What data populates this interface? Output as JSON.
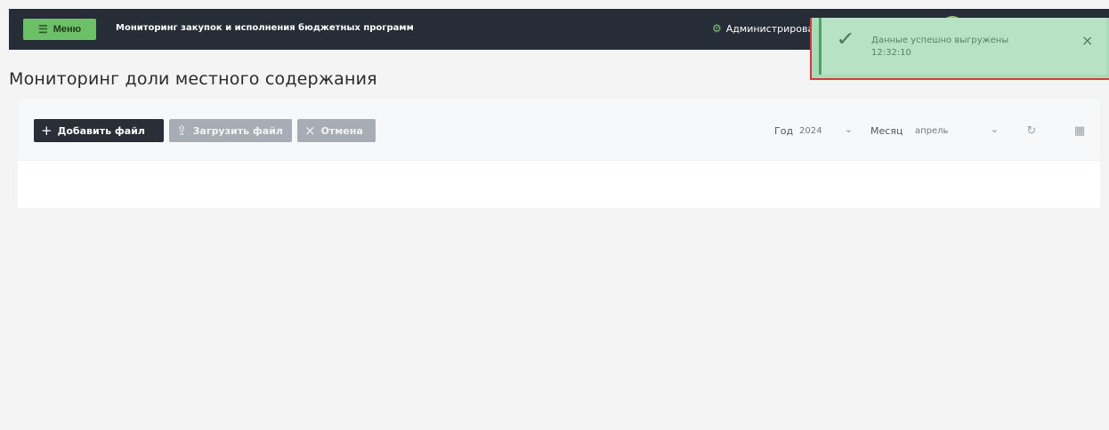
{
  "header": {
    "menu_label": "Меню",
    "app_title": "Мониторинг закупок и исполнения бюджетных программ",
    "admin_label": "Администрирование",
    "user_name": ""
  },
  "page": {
    "title": "Мониторинг доли местного содержания"
  },
  "toolbar": {
    "add_file_label": "Добавить файл",
    "upload_file_label": "Загрузить файл",
    "cancel_label": "Отмена",
    "year_label": "Год",
    "year_value": "2024",
    "month_label": "Месяц",
    "month_value": "апрель"
  },
  "toast": {
    "message": "Данные успешно выгружены",
    "time": "12:32:10"
  },
  "colors": {
    "topbar": "#262d36",
    "accent": "#6cc068",
    "toast_bg": "#b7e2c3",
    "highlight": "#d9383f"
  },
  "icons": {
    "menu": "hamburger-icon",
    "admin": "gear-icon",
    "add": "plus-icon",
    "upload": "upload-icon",
    "cancel": "close-icon",
    "refresh": "refresh-icon",
    "excel": "excel-icon",
    "toast_check": "check-icon",
    "toast_close": "close-icon"
  }
}
